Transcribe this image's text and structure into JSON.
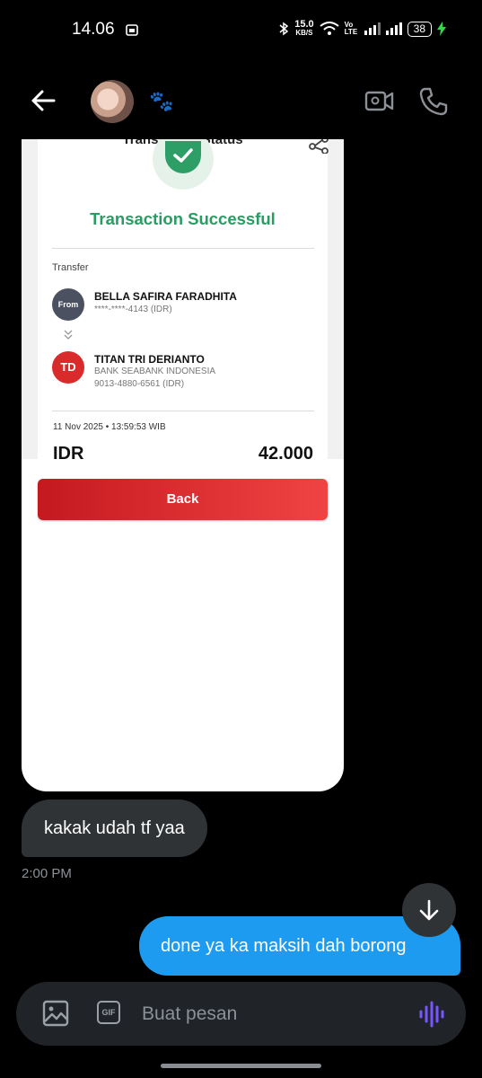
{
  "status_bar": {
    "time": "14.06",
    "net_speed": "15.0",
    "net_unit": "KB/S",
    "volte": "Vo LTE",
    "battery": "38"
  },
  "header": {
    "contact_emoji": "🐾"
  },
  "shared_screenshot": {
    "header_title": "Transaction Status",
    "result": "Transaction Successful",
    "type_label": "Transfer",
    "from_badge": "From",
    "from_name": "BELLA SAFIRA FARADHITA",
    "from_account": "****-****-4143 (IDR)",
    "to_badge": "TD",
    "to_name": "TITAN TRI DERIANTO",
    "to_bank": "BANK SEABANK INDONESIA",
    "to_account": "9013-4880-6561 (IDR)",
    "datetime": "11 Nov 2025 • 13:59:53 WIB",
    "currency": "IDR",
    "amount": "42.000",
    "back_button": "Back"
  },
  "messages": {
    "incoming_text": "kakak udah tf yaa",
    "incoming_time": "2:00 PM",
    "outgoing_text": "done ya ka maksih dah borong"
  },
  "composer": {
    "placeholder": "Buat pesan",
    "gif_label": "GIF"
  },
  "colors": {
    "accent_blue": "#1d9bf0",
    "success_green": "#2a9b62",
    "bank_red": "#d92b2b"
  }
}
